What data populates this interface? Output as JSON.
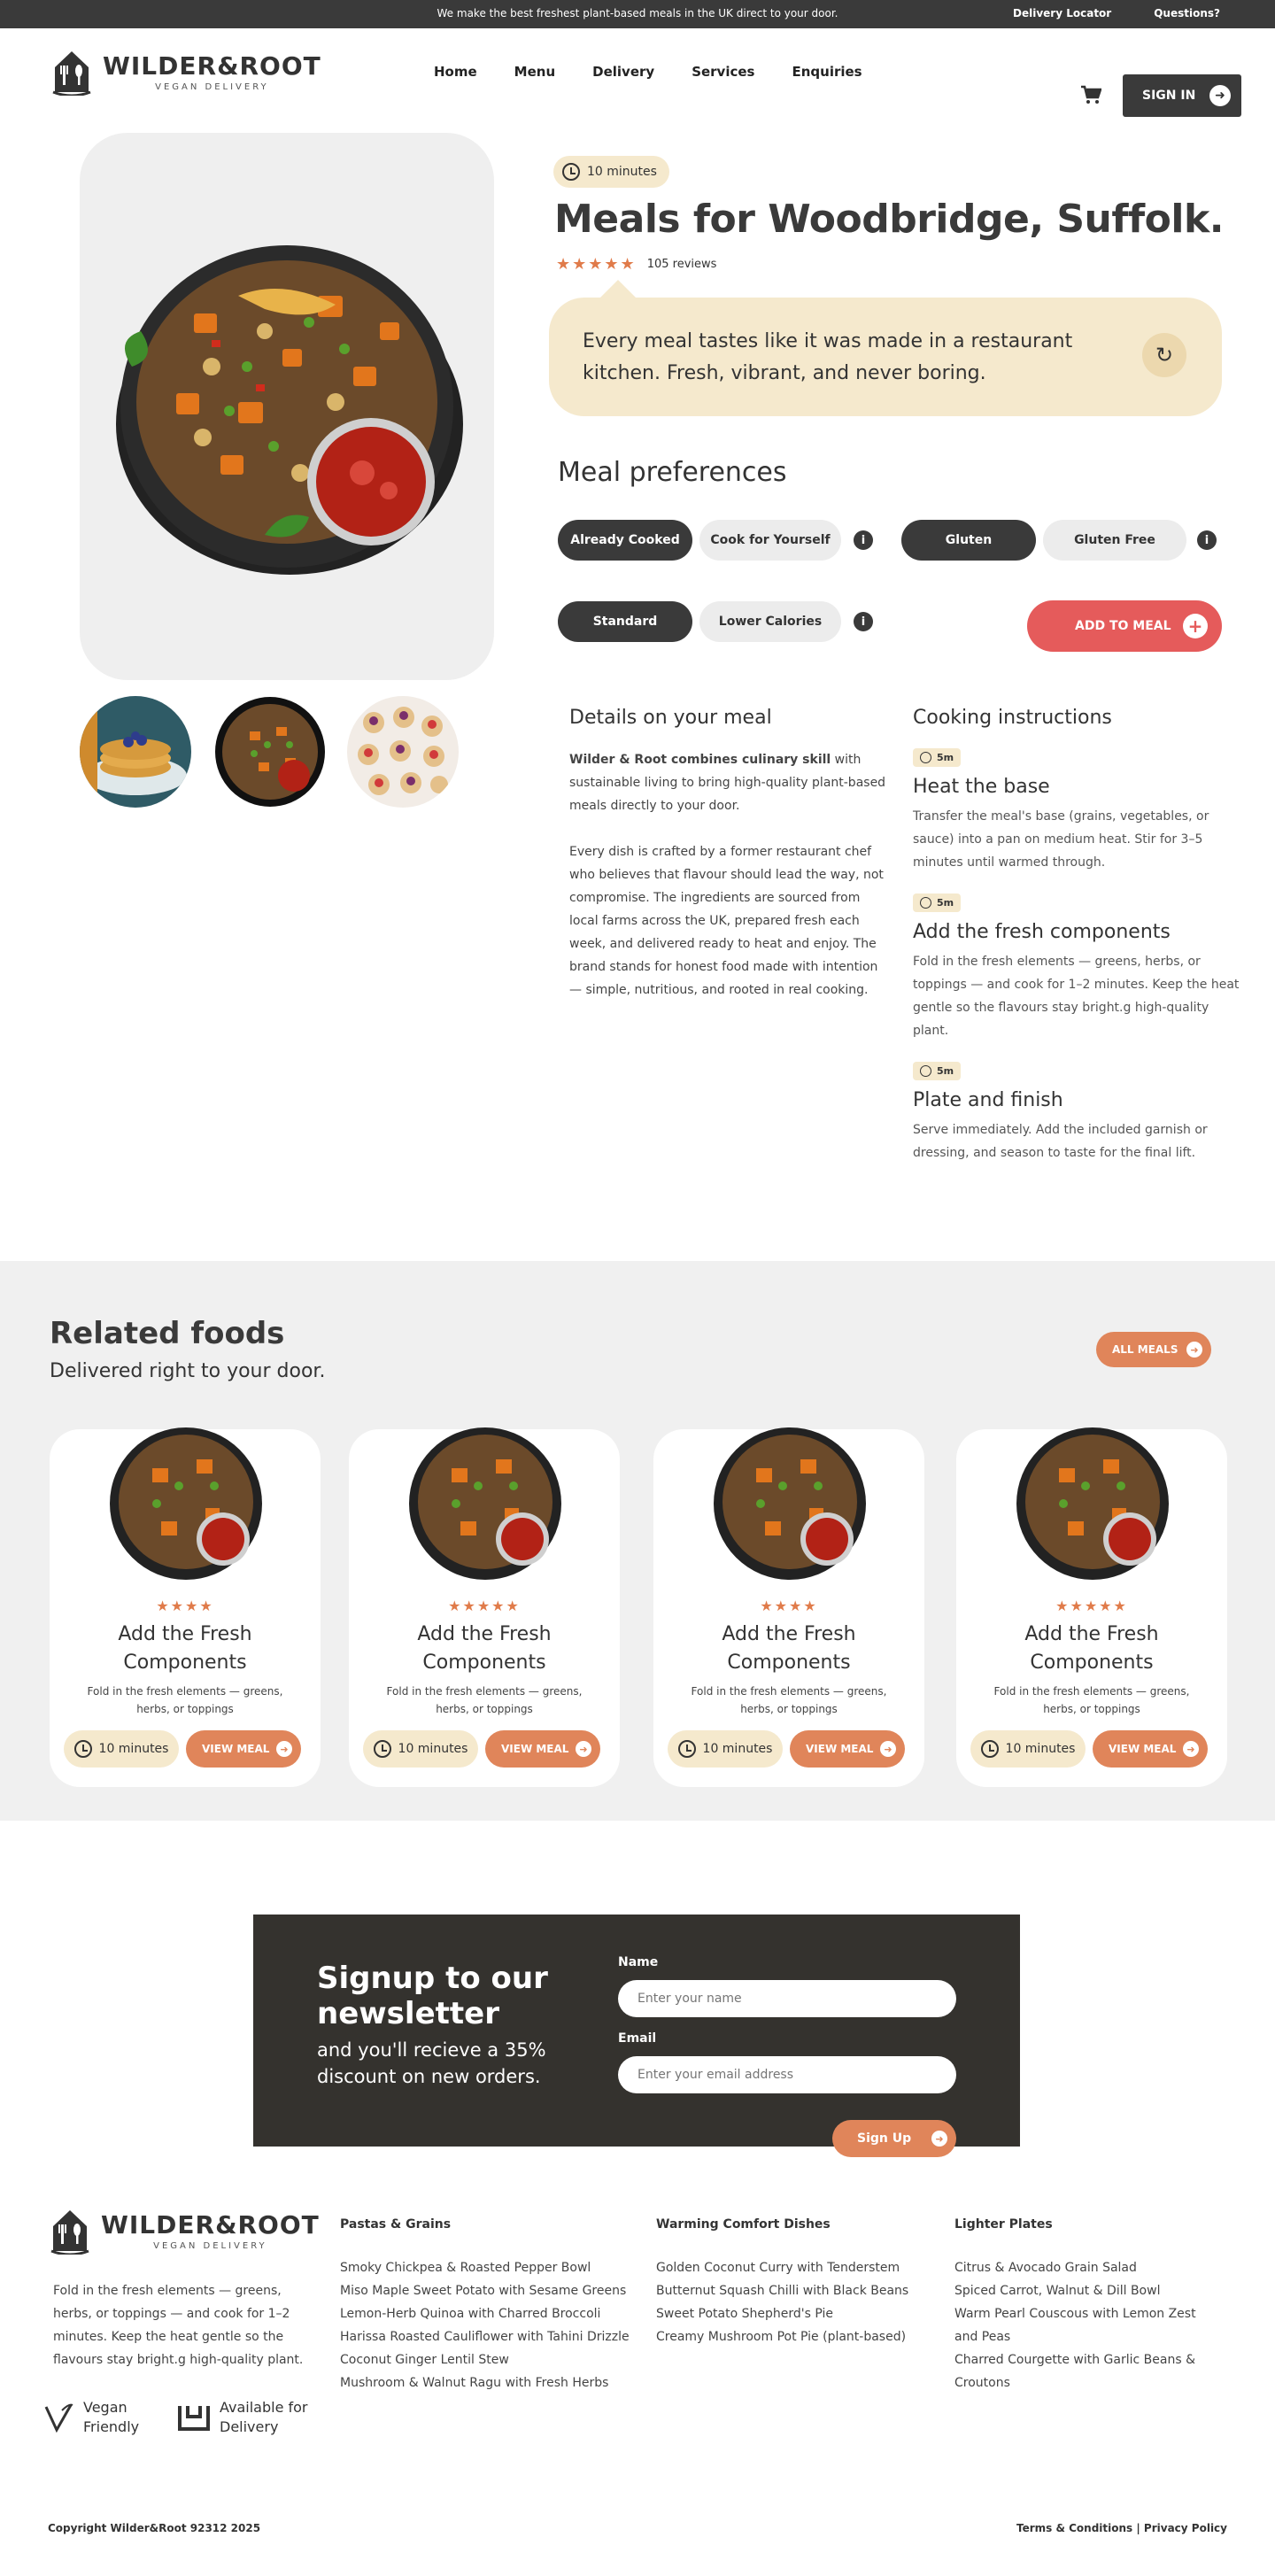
{
  "topbar": {
    "message": "We make the best freshest plant-based meals in the UK direct to your door.",
    "links": [
      "Delivery Locator",
      "Questions?"
    ]
  },
  "brand": {
    "name": "WILDER&ROOT",
    "tagline": "VEGAN DELIVERY"
  },
  "nav": [
    "Home",
    "Menu",
    "Delivery",
    "Services",
    "Enquiries"
  ],
  "signin": {
    "label": "SIGN IN"
  },
  "hero": {
    "time": "10 minutes",
    "title": "Meals for Woodbridge, Suffolk.",
    "stars": "★★★★★",
    "reviews": "105 reviews",
    "quote": "Every meal tastes like it was made in a restaurant kitchen. Fresh, vibrant, and never boring."
  },
  "preferences": {
    "title": "Meal preferences",
    "cook_options": [
      "Already Cooked",
      "Cook for Yourself"
    ],
    "gluten_options": [
      "Gluten",
      "Gluten Free"
    ],
    "calorie_options": [
      "Standard",
      "Lower Calories"
    ],
    "info_icon": "i",
    "add_to_meal": "ADD TO MEAL"
  },
  "details": {
    "title": "Details on your meal",
    "brand_bold": "Wilder & Root combines culinary skill",
    "intro_rest": " with sustainable living to bring high-quality plant-based meals directly to your door.",
    "body": "Every dish is crafted by a former restaurant chef who believes that flavour should lead the way, not compromise. The ingredients are sourced from local farms across the UK, prepared fresh each week, and delivered ready to heat and enjoy. The brand stands for honest food made with intention — simple, nutritious, and rooted in real cooking."
  },
  "cooking": {
    "title": "Cooking instructions",
    "steps": [
      {
        "time": "5m",
        "title": "Heat the base",
        "text": "Transfer the meal's base (grains, vegetables, or sauce) into a pan on medium heat. Stir for 3–5 minutes until warmed through."
      },
      {
        "time": "5m",
        "title": "Add the fresh components",
        "text": "Fold in the fresh elements — greens, herbs, or toppings — and cook for 1–2 minutes. Keep the heat gentle so the flavours stay bright.g high-quality plant."
      },
      {
        "time": "5m",
        "title": "Plate and finish",
        "text": "Serve immediately. Add the included garnish or dressing, and season to taste for the final lift."
      }
    ]
  },
  "related": {
    "title": "Related foods",
    "subtitle": "Delivered right to your door.",
    "all_meals": "ALL MEALS",
    "cards": [
      {
        "stars": "★★★★",
        "rating": 4,
        "title": "Add the Fresh Components",
        "desc": "Fold in the fresh elements — greens, herbs, or toppings",
        "time": "10 minutes",
        "button": "VIEW MEAL"
      },
      {
        "stars": "★★★★★",
        "rating": 5,
        "title": "Add the Fresh Components",
        "desc": "Fold in the fresh elements — greens, herbs, or toppings",
        "time": "10 minutes",
        "button": "VIEW MEAL"
      },
      {
        "stars": "★★★★",
        "rating": 4,
        "title": "Add the Fresh Components",
        "desc": "Fold in the fresh elements — greens, herbs, or toppings",
        "time": "10 minutes",
        "button": "VIEW MEAL"
      },
      {
        "stars": "★★★★★",
        "rating": 5,
        "title": "Add the Fresh Components",
        "desc": "Fold in the fresh elements — greens, herbs, or toppings",
        "time": "10 minutes",
        "button": "VIEW MEAL"
      }
    ]
  },
  "newsletter": {
    "title": "Signup to our newsletter",
    "offer": "and you'll recieve a 35% discount on new orders.",
    "name_label": "Name",
    "name_placeholder": "Enter your name",
    "email_label": "Email",
    "email_placeholder": "Enter your email address",
    "button": "Sign Up"
  },
  "footer": {
    "description": "Fold in the fresh elements — greens, herbs, or toppings — and cook for 1–2 minutes. Keep the heat gentle so the flavours stay bright.g high-quality plant.",
    "badges": [
      "Vegan Friendly",
      "Available for Delivery"
    ],
    "columns": [
      {
        "title": "Pastas & Grains",
        "items": [
          "Smoky Chickpea & Roasted Pepper Bowl",
          "Miso Maple Sweet Potato with Sesame Greens",
          "Lemon-Herb Quinoa with Charred Broccoli",
          "Harissa Roasted Cauliflower with Tahini Drizzle",
          "Coconut Ginger Lentil Stew",
          "Mushroom & Walnut Ragu with Fresh Herbs"
        ]
      },
      {
        "title": "Warming Comfort Dishes",
        "items": [
          "Golden Coconut Curry with Tenderstem",
          "Butternut Squash Chilli with Black Beans",
          "Sweet Potato Shepherd's Pie",
          "Creamy Mushroom Pot Pie (plant-based)"
        ]
      },
      {
        "title": "Lighter Plates",
        "items": [
          "Citrus & Avocado Grain Salad",
          "Spiced Carrot, Walnut & Dill Bowl",
          "Warm Pearl Couscous with Lemon Zest and Peas",
          "Charred Courgette with Garlic Beans & Croutons"
        ]
      }
    ],
    "copyright": "Copyright Wilder&Root 92312 2025",
    "legal": "Terms & Conditions | Privacy Policy"
  },
  "colors": {
    "accent": "#e0855a",
    "add_button": "#e55b5b",
    "cream": "#f5e9cd",
    "dark": "#3a3a3a"
  }
}
